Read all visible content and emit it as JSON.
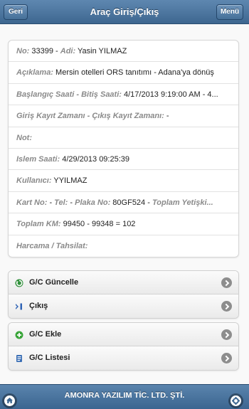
{
  "header": {
    "title": "Araç Giriş/Çıkış",
    "back_label": "Geri",
    "menu_label": "Menü"
  },
  "info": {
    "rows": [
      {
        "parts": [
          {
            "t": "No:",
            "l": true
          },
          {
            "t": " 33399 - ",
            "l": false
          },
          {
            "t": "Adi:",
            "l": true
          },
          {
            "t": " Yasin YILMAZ",
            "l": false
          }
        ]
      },
      {
        "parts": [
          {
            "t": "Açıklama:",
            "l": true
          },
          {
            "t": " Mersin otelleri ORS tanıtımı - Adana'ya dönüş",
            "l": false
          }
        ]
      },
      {
        "parts": [
          {
            "t": "Başlangıç Saati - Bitiş Saati:",
            "l": true
          },
          {
            "t": " 4/17/2013 9:19:00 AM - 4...",
            "l": false
          }
        ]
      },
      {
        "parts": [
          {
            "t": "Giriş Kayıt Zamanı - Çıkış Kayıt Zamanı:",
            "l": true
          },
          {
            "t": "  -",
            "l": false
          }
        ]
      },
      {
        "parts": [
          {
            "t": "Not:",
            "l": true
          }
        ]
      },
      {
        "parts": [
          {
            "t": "Islem Saati:",
            "l": true
          },
          {
            "t": " 4/29/2013 09:25:39",
            "l": false
          }
        ]
      },
      {
        "parts": [
          {
            "t": "Kullanıcı:",
            "l": true
          },
          {
            "t": " YYILMAZ",
            "l": false
          }
        ]
      },
      {
        "parts": [
          {
            "t": "Kart No:",
            "l": true
          },
          {
            "t": "  - ",
            "l": false
          },
          {
            "t": "Tel:",
            "l": true
          },
          {
            "t": "  - ",
            "l": false
          },
          {
            "t": "Plaka No:",
            "l": true
          },
          {
            "t": " 80GF524 - ",
            "l": false
          },
          {
            "t": "Toplam Yetişki...",
            "l": true
          }
        ]
      },
      {
        "parts": [
          {
            "t": "Toplam KM:",
            "l": true
          },
          {
            "t": " 99450 - 99348 = 102",
            "l": false
          }
        ]
      },
      {
        "parts": [
          {
            "t": "Harcama / Tahsilat:",
            "l": true
          }
        ]
      }
    ]
  },
  "actions": {
    "group1": [
      {
        "label": "G/C Güncelle",
        "icon": "refresh-icon"
      },
      {
        "label": "Çıkış",
        "icon": "exit-arrow-icon"
      }
    ],
    "group2": [
      {
        "label": "G/C Ekle",
        "icon": "add-icon"
      },
      {
        "label": "G/C Listesi",
        "icon": "list-icon"
      }
    ]
  },
  "footer": {
    "title": "AMONRA YAZILIM TİC. LTD. ŞTİ.",
    "left_icon": "home-icon",
    "right_icon": "gear-icon"
  },
  "colors": {
    "header_bg": "#4a74a0",
    "label_gray": "#8a8a8a",
    "green_icon": "#3aa53a",
    "blue_icon": "#2f63b5"
  }
}
